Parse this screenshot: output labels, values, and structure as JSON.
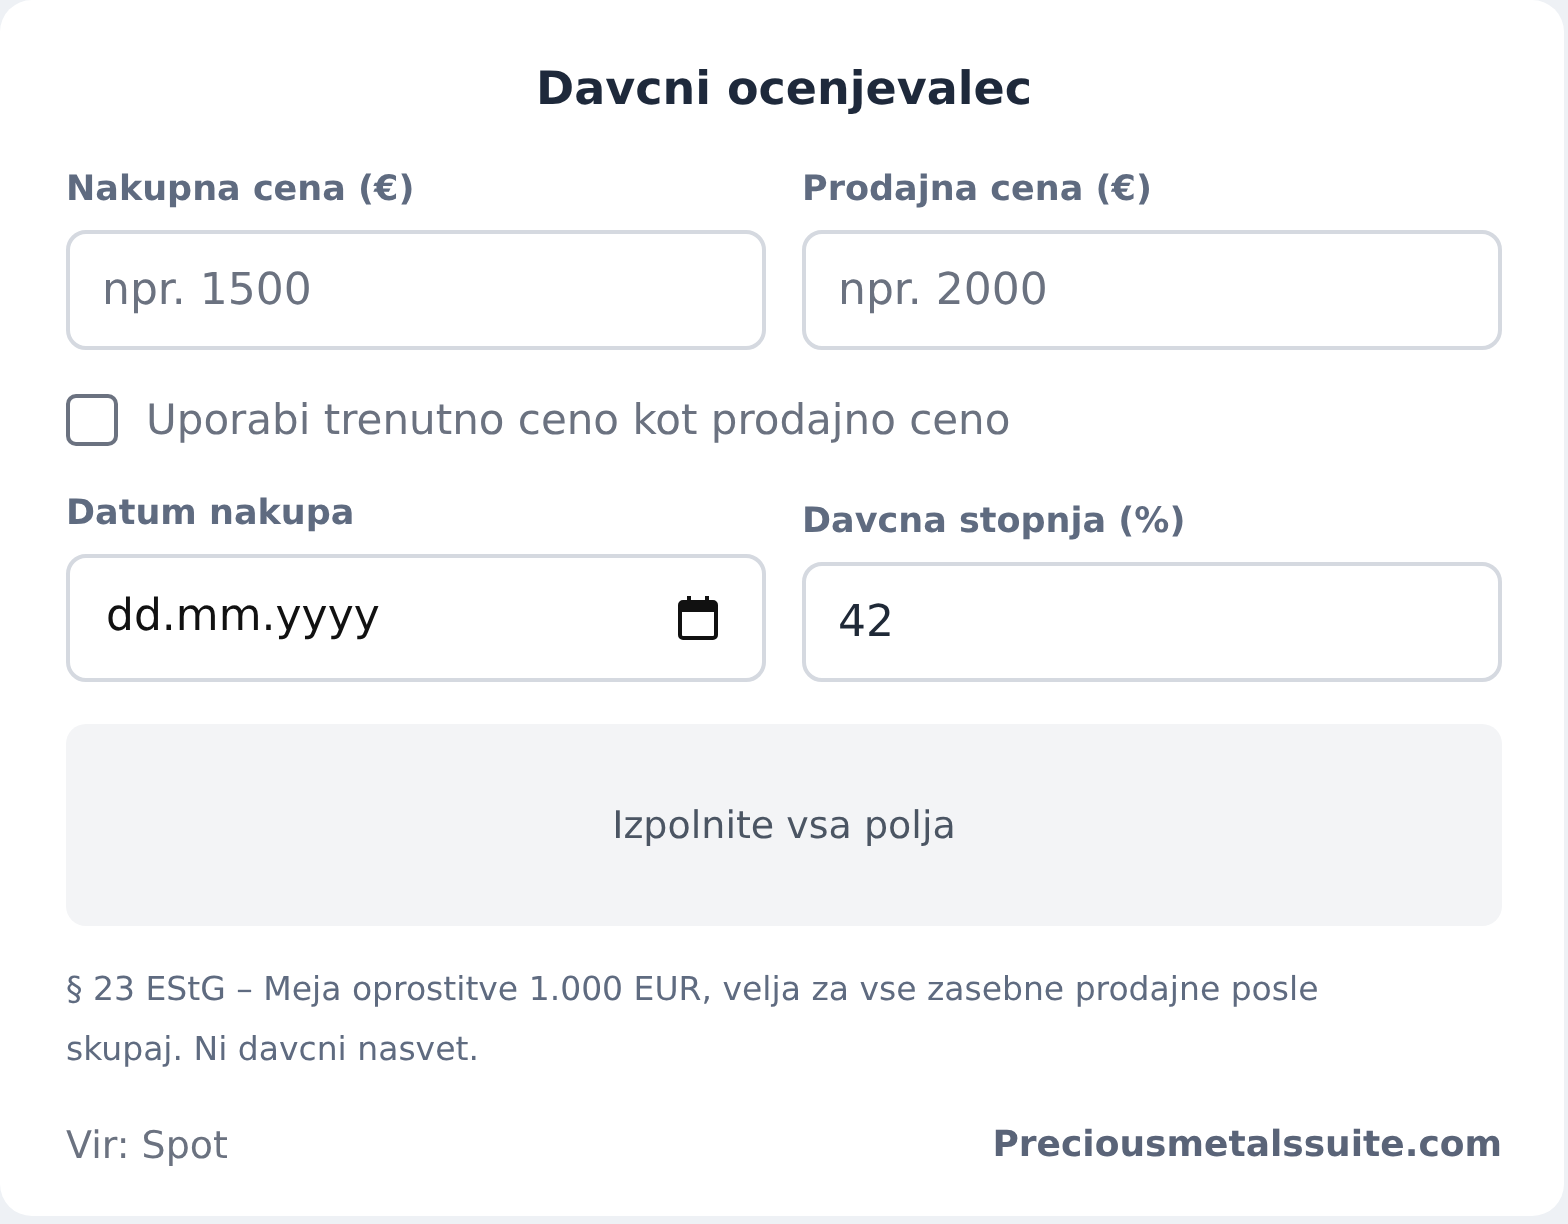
{
  "title": "Davcni ocenjevalec",
  "price_fields": [
    {
      "kind": "number",
      "label": "Nakupna cena (€)",
      "placeholder": "npr. 1500"
    },
    {
      "kind": "number",
      "label": "Prodajna cena (€)",
      "placeholder": "npr. 2000"
    }
  ],
  "current_price_option": {
    "label": "Uporabi trenutno ceno kot prodajno ceno",
    "checked": false
  },
  "detail_fields": [
    {
      "kind": "date",
      "label": "Datum nakupa",
      "format": "dd.mm.yyyy"
    },
    {
      "kind": "number",
      "label": "Davcna stopnja (%)",
      "value": "42"
    }
  ],
  "result": {
    "message": "Izpolnite vsa polja"
  },
  "note": "§ 23 EStG – Meja oprostitve 1.000 EUR, velja za vse zasebne prodajne posle skupaj. Ni davcni nasvet.",
  "footer": {
    "source": "Vir: Spot",
    "brand": "Preciousmetalssuite.com"
  }
}
